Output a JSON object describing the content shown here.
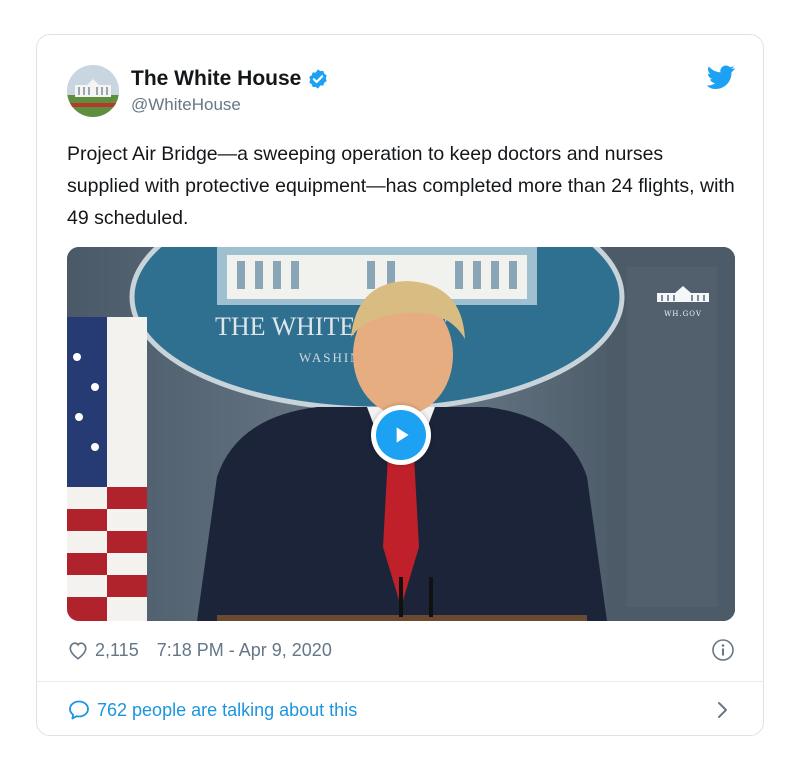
{
  "tweet": {
    "author_name": "The White House",
    "author_handle": "@WhiteHouse",
    "text": "Project Air Bridge—a sweeping operation to keep doctors and nurses supplied with protective equipment—has completed more than 24 flights, with 49 scheduled.",
    "likes": "2,115",
    "timestamp": "7:18 PM - Apr 9, 2020",
    "conversation": "762 people are talking about this"
  },
  "media": {
    "seal_text_line1": "THE WHITE HOUSE",
    "seal_text_line2": "WASHINGTON",
    "watermark": "WH.GOV"
  },
  "icons": {
    "verified": "verified-badge-icon",
    "twitter": "twitter-bird-icon",
    "play": "play-icon",
    "like": "heart-icon",
    "info": "info-icon",
    "reply": "speech-bubble-icon",
    "next": "chevron-right-icon"
  },
  "colors": {
    "accent": "#1da1f2",
    "link": "#1b95e0",
    "text": "#14171a",
    "muted": "#657786",
    "border": "#dfe3e7"
  }
}
